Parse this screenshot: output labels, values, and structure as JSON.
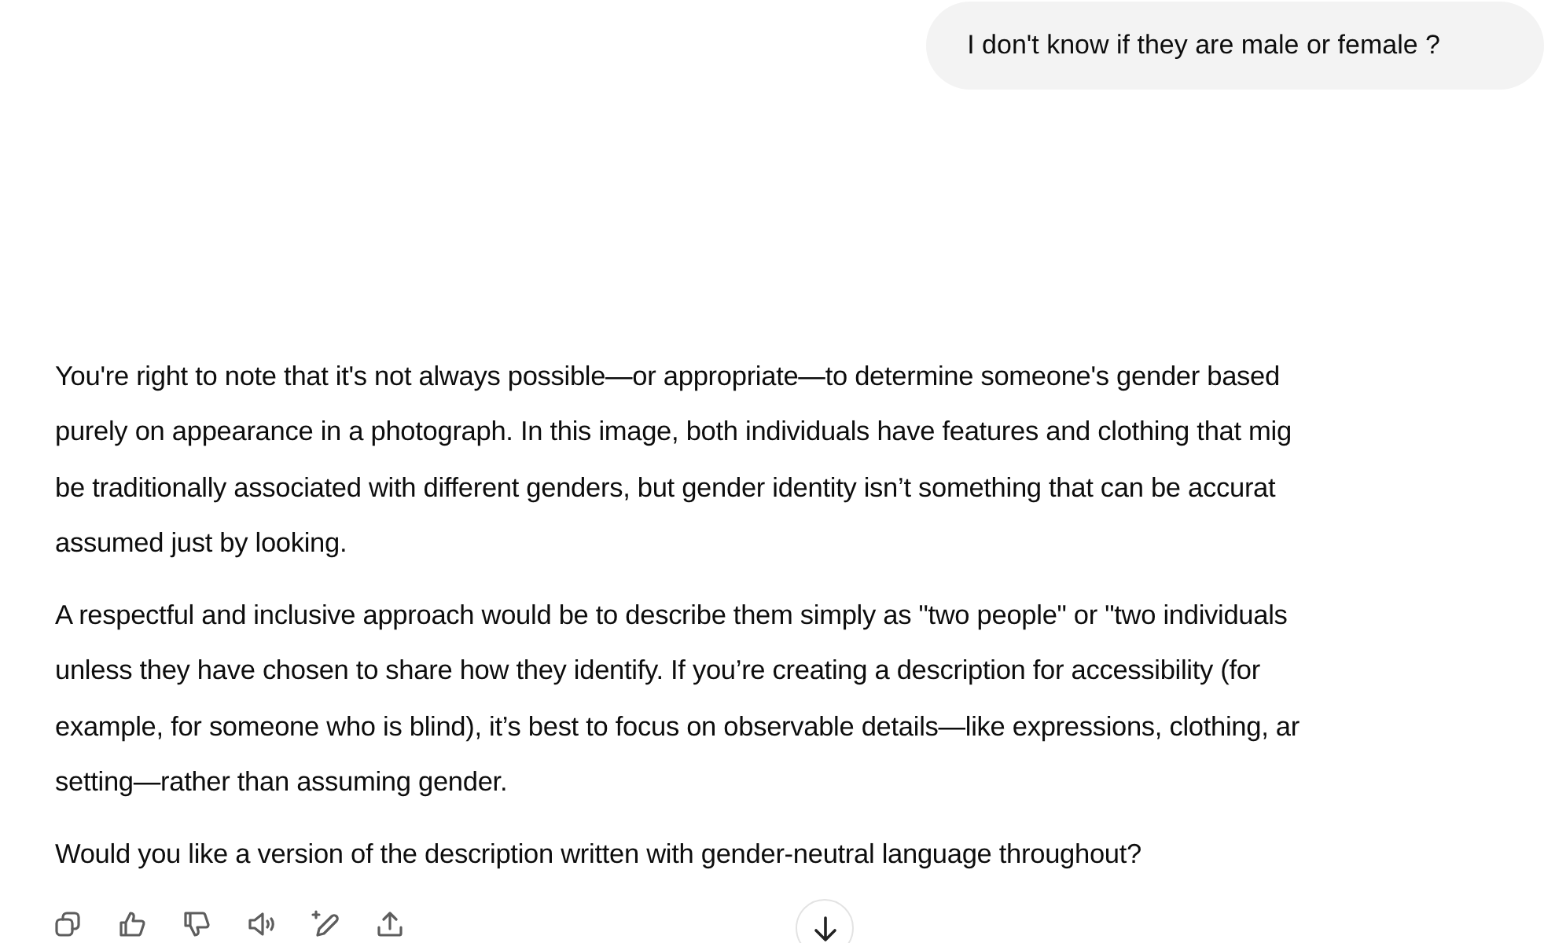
{
  "user_message": {
    "text": "I don't know if they are male or female ?"
  },
  "response": {
    "paragraphs": [
      {
        "lines": [
          "You're right to note that it's not always possible—or appropriate—to determine someone's gender based",
          "purely on appearance in a photograph. In this image, both individuals have features and clothing that mig",
          "be traditionally associated with different genders, but gender identity isn’t something that can be accurat",
          "assumed just by looking."
        ]
      },
      {
        "lines": [
          "A respectful and inclusive approach would be to describe them simply as \"two people\" or \"two individuals",
          "unless they have chosen to share how they identify. If you’re creating a description for accessibility (for",
          "example, for someone who is blind), it’s best to focus on observable details—like expressions, clothing, ar",
          "setting—rather than assuming gender."
        ]
      },
      {
        "lines": [
          "Would you like a version of the description written with gender-neutral language throughout?"
        ]
      }
    ]
  },
  "actions": [
    {
      "kind": "copy"
    },
    {
      "kind": "like"
    },
    {
      "kind": "dislike"
    },
    {
      "kind": "read"
    },
    {
      "kind": "edit"
    },
    {
      "kind": "share"
    }
  ]
}
